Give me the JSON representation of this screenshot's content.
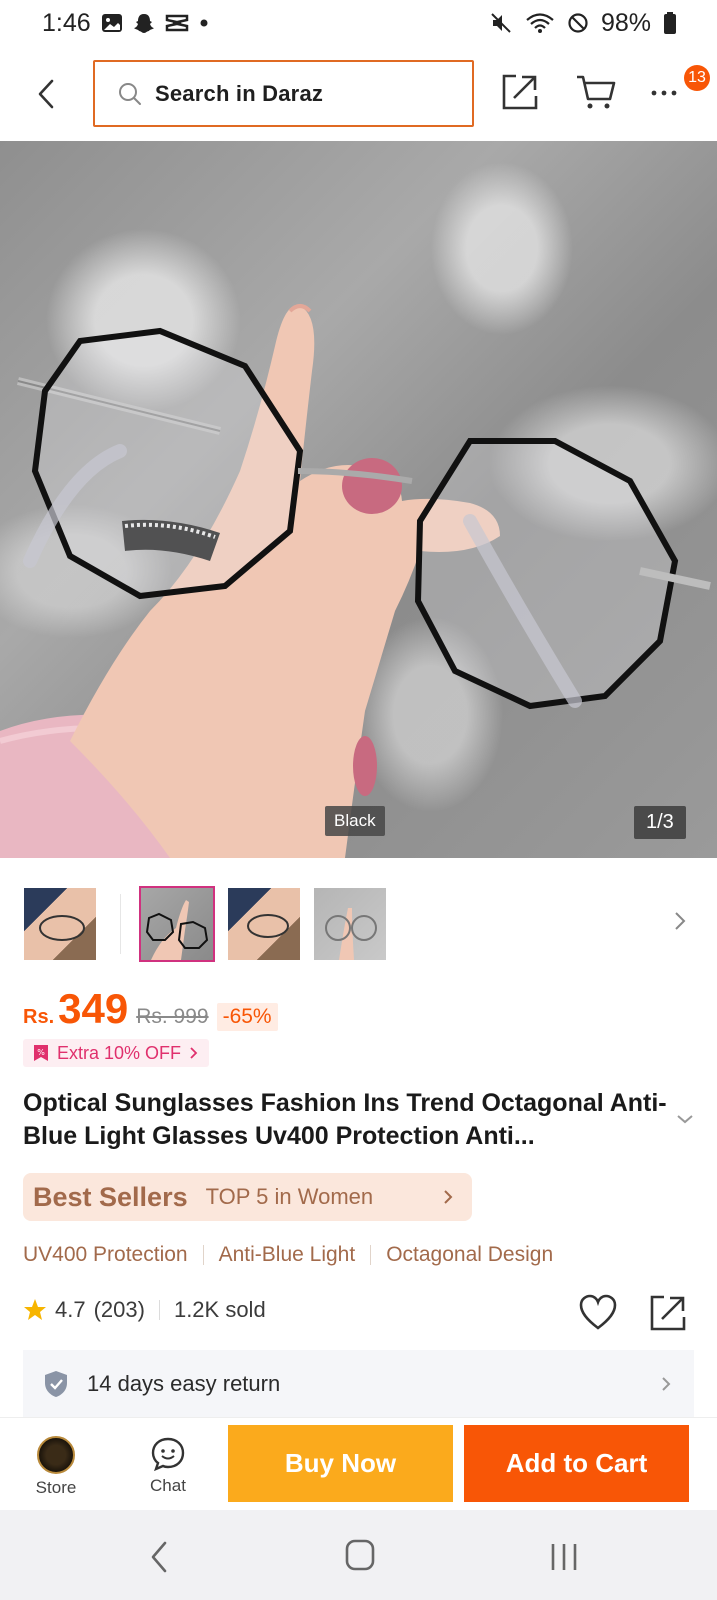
{
  "status_bar": {
    "time": "1:46",
    "battery": "98%"
  },
  "header": {
    "search_placeholder": "Search in Daraz",
    "notification_count": "13"
  },
  "gallery": {
    "variant_label": "Black",
    "counter": "1/3",
    "thumbnail_count": 4,
    "selected_thumbnail": 2
  },
  "price": {
    "currency": "Rs.",
    "current": "349",
    "original": "Rs. 999",
    "discount": "-65%",
    "voucher": "Extra 10% OFF"
  },
  "product": {
    "title": "Optical Sunglasses Fashion Ins Trend Octagonal Anti-Blue Light Glasses Uv400 Protection Anti..."
  },
  "best_sellers": {
    "title": "Best Sellers",
    "rank_text": "TOP 5 in Women"
  },
  "tags": [
    "UV400 Protection",
    "Anti-Blue Light",
    "Octagonal Design"
  ],
  "rating": {
    "score": "4.7",
    "count": "(203)",
    "sold": "1.2K sold"
  },
  "return_policy": {
    "text": "14 days easy return"
  },
  "bottom_bar": {
    "store_label": "Store",
    "chat_label": "Chat",
    "buy_now": "Buy Now",
    "add_to_cart": "Add to Cart"
  },
  "colors": {
    "accent": "#f85606",
    "buy_now": "#fbaa1c",
    "best_seller_bg": "#fbe7dc",
    "best_seller_text": "#a26a4b",
    "voucher": "#e0306d"
  }
}
